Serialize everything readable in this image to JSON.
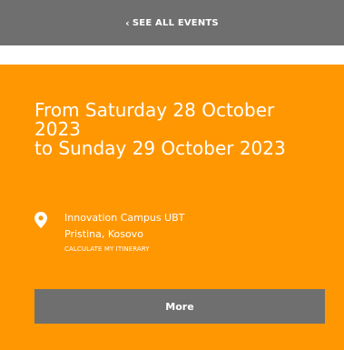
{
  "nav": {
    "see_all_label": "SEE ALL EVENTS",
    "chevron": "‹"
  },
  "event": {
    "date_line1": "From Saturday 28 October",
    "date_line2": "2023",
    "date_line3": "to Sunday 29 October 2023",
    "venue": "Innovation Campus UBT",
    "city": "Pristina, Kosovo",
    "itinerary_label": "CALCULATE MY ITINERARY",
    "more_label": "More"
  },
  "icons": {
    "back": "chevron-left-icon",
    "location": "location-pin-icon"
  },
  "colors": {
    "bar": "#6f6f6f",
    "card": "#ff9702",
    "text": "#ffffff"
  }
}
